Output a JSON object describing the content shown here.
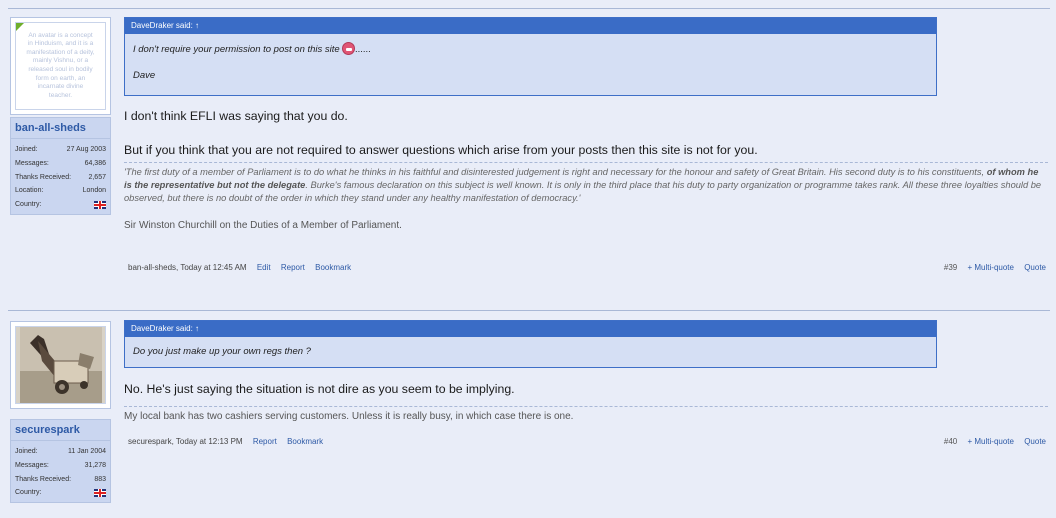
{
  "post1": {
    "user": {
      "name": "ban-all-sheds",
      "avatar_alt": "An avatar is a concept in Hinduism, and it is a manifestation of a deity, mainly Vishnu, or a released soul in bodily form on earth, an incarnate divine teacher.",
      "stats": [
        {
          "label": "Joined:",
          "value": "27 Aug 2003"
        },
        {
          "label": "Messages:",
          "value": "64,386"
        },
        {
          "label": "Thanks Received:",
          "value": "2,657"
        },
        {
          "label": "Location:",
          "value": "London"
        },
        {
          "label": "Country:",
          "value": ""
        }
      ]
    },
    "quote": {
      "header": "DaveDraker said: ↑",
      "line1": "I don't require your permission to post on this site",
      "line1_tail": "......",
      "line2": "Dave"
    },
    "message": {
      "line1": "I don't think EFLI was saying that you do.",
      "line2": "But if you think that you are not required to answer questions which arise from your posts then this site is not for you."
    },
    "signature": {
      "part1": "'The first duty of a member of Parliament is to do what he thinks in his faithful and disinterested judgement is right and necessary for the honour and safety of Great Britain. His second duty is to his constituents,",
      "bold": "of whom he is the representative but not the delegate",
      "part2": ". Burke's famous declaration on this subject is well known. It is only in the third place that his duty to party organization or programme takes rank. All these three loyalties should be observed, but there is no doubt of the order in which they stand under any healthy manifestation of democracy.'",
      "attribution": "Sir Winston Churchill on the Duties of a Member of Parliament."
    },
    "meta": {
      "author_time": "ban-all-sheds, Today at 12:45 AM",
      "edit": "Edit",
      "report": "Report",
      "bookmark": "Bookmark",
      "number": "#39",
      "multiquote": "+ Multi-quote",
      "quote": "Quote"
    }
  },
  "post2": {
    "user": {
      "name": "securespark",
      "stats": [
        {
          "label": "Joined:",
          "value": "11 Jan 2004"
        },
        {
          "label": "Messages:",
          "value": "31,278"
        },
        {
          "label": "Thanks Received:",
          "value": "883"
        },
        {
          "label": "Country:",
          "value": ""
        }
      ]
    },
    "quote": {
      "header": "DaveDraker said: ↑",
      "line1": "Do you just make up your own regs then ?"
    },
    "message": {
      "line1": "No. He's just saying the situation is not dire as you seem to be implying."
    },
    "signature": {
      "text": "My local bank has two cashiers serving customers. Unless it is really busy, in which case there is one."
    },
    "meta": {
      "author_time": "securespark, Today at 12:13 PM",
      "report": "Report",
      "bookmark": "Bookmark",
      "number": "#40",
      "multiquote": "+ Multi-quote",
      "quote": "Quote"
    }
  }
}
